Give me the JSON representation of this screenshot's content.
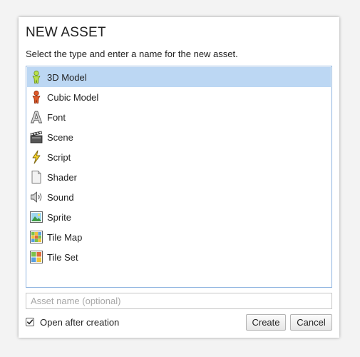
{
  "dialog": {
    "title": "NEW ASSET",
    "subtitle": "Select the type and enter a name for the new asset."
  },
  "asset_types": [
    {
      "label": "3D Model",
      "icon": "3d-model-icon",
      "selected": true
    },
    {
      "label": "Cubic Model",
      "icon": "cubic-model-icon",
      "selected": false
    },
    {
      "label": "Font",
      "icon": "font-icon",
      "selected": false
    },
    {
      "label": "Scene",
      "icon": "scene-clapperboard-icon",
      "selected": false
    },
    {
      "label": "Script",
      "icon": "script-lightning-icon",
      "selected": false
    },
    {
      "label": "Shader",
      "icon": "shader-document-icon",
      "selected": false
    },
    {
      "label": "Sound",
      "icon": "sound-speaker-icon",
      "selected": false
    },
    {
      "label": "Sprite",
      "icon": "sprite-image-icon",
      "selected": false
    },
    {
      "label": "Tile Map",
      "icon": "tile-map-icon",
      "selected": false
    },
    {
      "label": "Tile Set",
      "icon": "tile-set-icon",
      "selected": false
    }
  ],
  "name_input": {
    "value": "",
    "placeholder": "Asset name (optional)"
  },
  "open_after_creation": {
    "label": "Open after creation",
    "checked": true
  },
  "buttons": {
    "create": "Create",
    "cancel": "Cancel"
  },
  "colors": {
    "selected_row": "#bcd7f3",
    "list_border": "#8fb5e0"
  }
}
